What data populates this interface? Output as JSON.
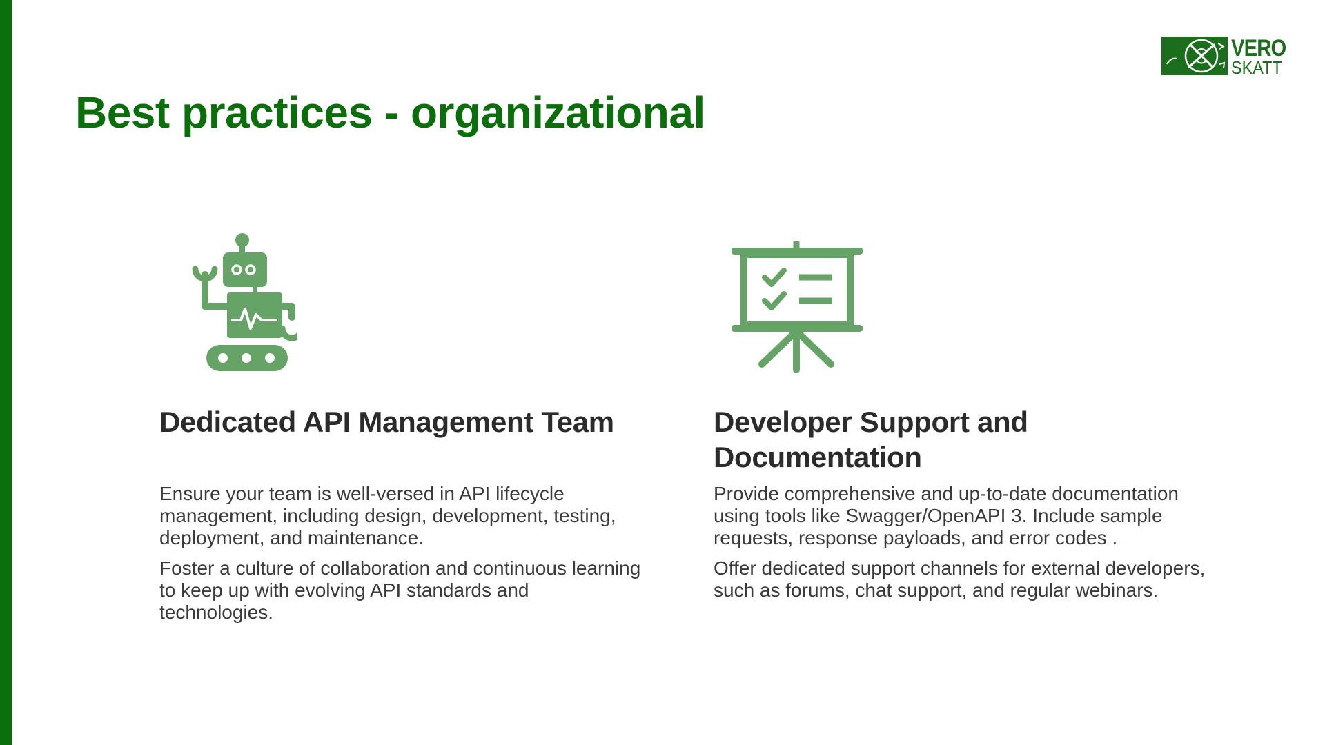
{
  "slide": {
    "title": "Best practices - organizational",
    "accent_color": "#0a6e0a",
    "icon_color": "#66a366",
    "text_color": "#2b2b2b"
  },
  "logo": {
    "line1": "VERO",
    "line2": "SKATT",
    "emblem_icon": "vero-emblem-icon"
  },
  "cards": [
    {
      "icon": "robot-icon",
      "heading": "Dedicated API Management Team",
      "paragraphs": [
        "Ensure your team is well-versed in API lifecycle management, including design, development, testing, deployment, and maintenance.",
        "Foster a culture of collaboration and continuous learning to keep up with evolving API standards and technologies."
      ]
    },
    {
      "icon": "presentation-board-icon",
      "heading": "Developer Support and Documentation",
      "paragraphs": [
        "Provide comprehensive and up-to-date documentation using tools like Swagger/OpenAPI 3. Include sample requests, response payloads, and error codes .",
        "Offer dedicated support channels for external developers, such as forums, chat support, and regular webinars."
      ]
    }
  ]
}
